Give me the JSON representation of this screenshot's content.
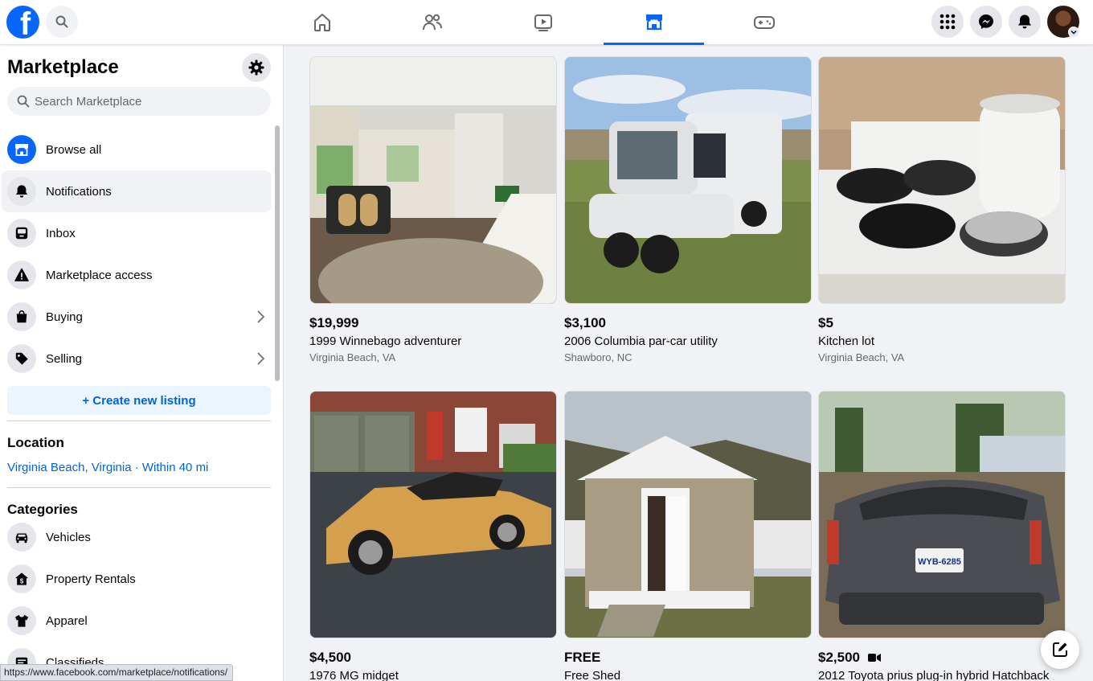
{
  "topbar": {
    "logo_letter": "f",
    "nav_tabs": [
      {
        "icon": "home-icon"
      },
      {
        "icon": "friends-icon"
      },
      {
        "icon": "watch-icon"
      },
      {
        "icon": "marketplace-icon",
        "active": true
      },
      {
        "icon": "gaming-icon"
      }
    ],
    "right_buttons": [
      "menu-grid-icon",
      "messenger-icon",
      "notifications-bell-icon"
    ]
  },
  "sidebar": {
    "title": "Marketplace",
    "search_placeholder": "Search Marketplace",
    "items": [
      {
        "label": "Browse all",
        "icon": "storefront-icon"
      },
      {
        "label": "Notifications",
        "icon": "bell-icon"
      },
      {
        "label": "Inbox",
        "icon": "inbox-icon"
      },
      {
        "label": "Marketplace access",
        "icon": "warning-icon"
      },
      {
        "label": "Buying",
        "icon": "shopping-bag-icon"
      },
      {
        "label": "Selling",
        "icon": "tag-icon"
      }
    ],
    "create_listing": "+ Create new listing",
    "location_heading": "Location",
    "location_value": "Virginia Beach, Virginia · Within 40 mi",
    "categories_heading": "Categories",
    "categories": [
      {
        "label": "Vehicles",
        "icon": "car-icon"
      },
      {
        "label": "Property Rentals",
        "icon": "house-dollar-icon"
      },
      {
        "label": "Apparel",
        "icon": "shirt-icon"
      },
      {
        "label": "Classifieds",
        "icon": "classifieds-icon"
      }
    ]
  },
  "status_url": "https://www.facebook.com/marketplace/notifications/",
  "listings": [
    {
      "price": "$19,999",
      "title": "1999 Winnebago adventurer",
      "location": "Virginia Beach, VA"
    },
    {
      "price": "$3,100",
      "title": "2006 Columbia par-car utility",
      "location": "Shawboro, NC"
    },
    {
      "price": "$5",
      "title": "Kitchen lot",
      "location": "Virginia Beach, VA"
    },
    {
      "price": "$4,500",
      "title": "1976 MG midget",
      "location": ""
    },
    {
      "price": "FREE",
      "title": "Free Shed",
      "location": ""
    },
    {
      "price": "$2,500",
      "title": "2012 Toyota prius plug-in hybrid Hatchback",
      "location": "",
      "video": true
    }
  ],
  "colors": {
    "brand": "#0866ff",
    "link": "#0064d1"
  }
}
